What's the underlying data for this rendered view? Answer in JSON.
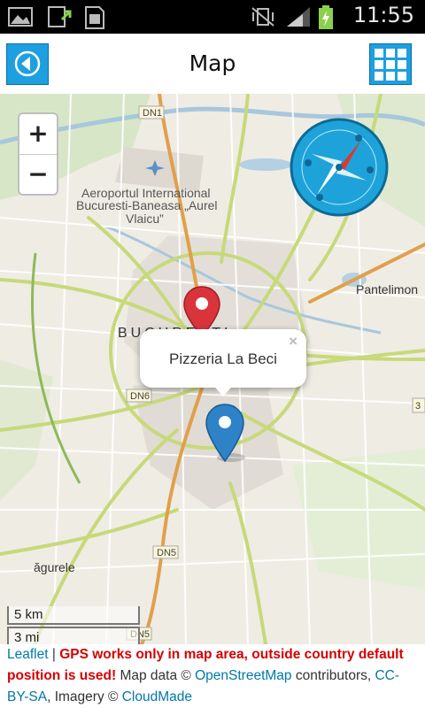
{
  "status_bar": {
    "time": "11:55",
    "icons": [
      "gallery-icon",
      "upload-icon",
      "sim-card-icon",
      "muted-vibrate-icon",
      "signal-icon",
      "battery-charging-icon"
    ]
  },
  "action_bar": {
    "title": "Map",
    "back_icon": "back-arrow-icon",
    "menu_icon": "grid-icon"
  },
  "map": {
    "zoom_in": "+",
    "zoom_out": "−",
    "compass_icon": "compass-icon",
    "place_labels": {
      "airport": "Aeroportul International",
      "airport_line2": "Bucuresti-Baneasa „Aurel",
      "airport_line3": "Vlaicu”",
      "city": "BUCURESTI",
      "pantelimon": "Pantelimon",
      "magurele": "ăgurele",
      "dn1": "DN1",
      "dn6": "DN6",
      "dn5a": "DN5",
      "dn5b": "DN5",
      "num3": "3"
    },
    "popup": {
      "text": "Pizzeria La Beci",
      "close": "×"
    },
    "markers": [
      {
        "color": "#d9343c",
        "name": "gps-position-marker"
      },
      {
        "color": "#2d82c8",
        "name": "pizzeria-marker"
      }
    ],
    "scale": {
      "metric": "5 km",
      "imperial": "3 mi"
    }
  },
  "attribution": {
    "leaflet": "Leaflet",
    "sep": " | ",
    "warning": "GPS works only in map area, outside country default position is used!",
    "map_data": " Map data © ",
    "osm": "OpenStreetMap",
    "contributors": " contributors, ",
    "license": "CC-BY-SA",
    "imagery": ", Imagery © ",
    "cloudmade": "CloudMade"
  },
  "colors": {
    "accent": "#1e9fe0",
    "warning": "#d50000",
    "link": "#0078a8"
  }
}
